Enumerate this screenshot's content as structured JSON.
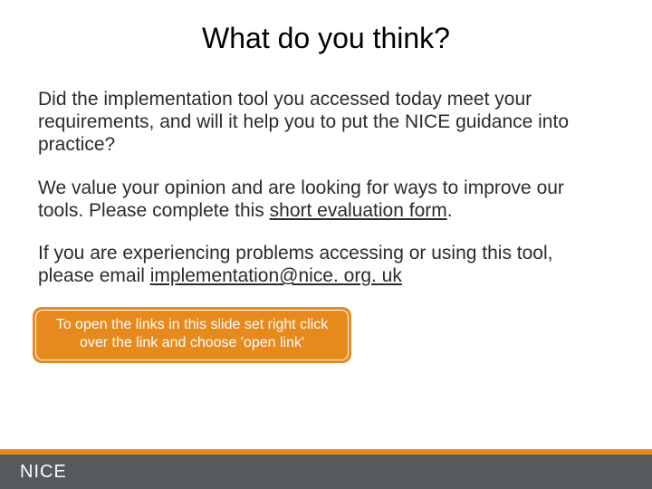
{
  "title": "What do you think?",
  "paragraphs": {
    "p1": "Did the implementation tool you accessed today meet your requirements, and will it help you to put the NICE guidance into practice?",
    "p2_pre": "We value your opinion and are looking for ways to improve our tools. Please complete this ",
    "p2_link": "short evaluation form",
    "p2_post": ".",
    "p3_pre": "If you are experiencing problems accessing or using this tool, please email ",
    "p3_link": "implementation@nice. org. uk"
  },
  "callout": "To open the links in this slide set right click over the link and choose 'open link'",
  "footer": {
    "logo": "NICE"
  },
  "colors": {
    "accent": "#e68a1e",
    "footer_bar": "#555a5d"
  }
}
